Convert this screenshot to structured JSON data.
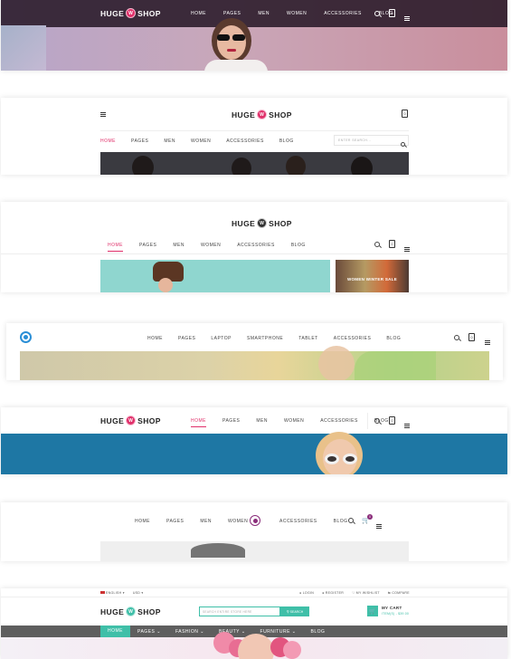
{
  "logo": {
    "left": "HUGE",
    "badge": "W",
    "right": "SHOP"
  },
  "nav": [
    "HOME",
    "PAGES",
    "MEN",
    "WOMEN",
    "ACCESSORIES",
    "BLOG"
  ],
  "nav_tech": [
    "HOME",
    "PAGES",
    "LAPTOP",
    "SMARTPHONE",
    "TABLET",
    "ACCESSORIES",
    "BLOG"
  ],
  "cart_count": "0",
  "search_placeholder": "ENTER SEARCH...",
  "promo_text": "WOMEN WINTER SALE",
  "topbar": {
    "language": "ENGLISH",
    "currency": "USD",
    "login": "LOGIN",
    "register": "REGISTER",
    "wishlist": "MY WISHLIST",
    "compare": "COMPARE"
  },
  "search7": {
    "placeholder": "SEARCH ENTIRE STORE HERE",
    "button": "SEARCH"
  },
  "cart7": {
    "label": "MY CART",
    "sub": "ITEM(S) - $39.00"
  },
  "nav7": [
    "HOME",
    "PAGES",
    "FASHION",
    "BEAUTY",
    "FURNITURE",
    "BLOG"
  ],
  "colors": {
    "accent": "#e0306a",
    "teal": "#3fbfa8",
    "dark_bar": "#5e5e5e",
    "blue_band": "#1e77a4"
  }
}
